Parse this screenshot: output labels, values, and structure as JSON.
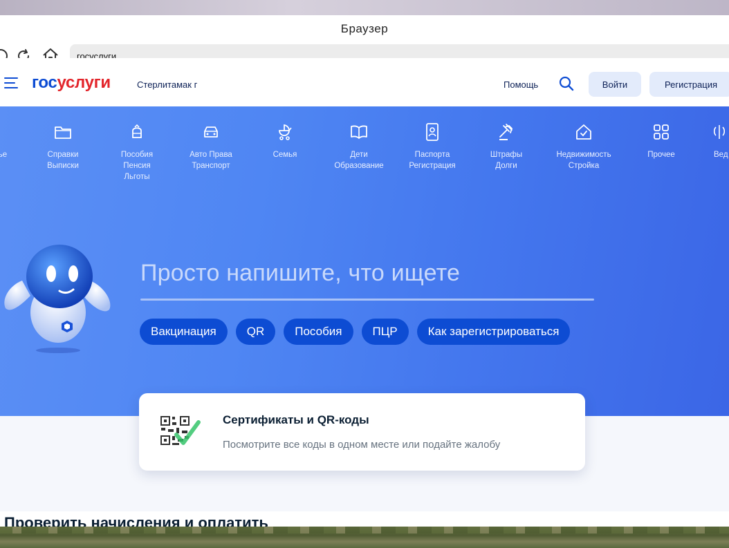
{
  "browser": {
    "title": "Браузер",
    "address": "госуслуги"
  },
  "header": {
    "logo_part1": "гос",
    "logo_part2": "услуги",
    "city": "Стерлитамак г",
    "help": "Помощь",
    "login": "Войти",
    "register": "Регистрация"
  },
  "categories": [
    {
      "label1": "ье",
      "label2": "",
      "label3": "",
      "icon": "partial-icon"
    },
    {
      "label1": "Справки",
      "label2": "Выписки",
      "label3": "",
      "icon": "folder-icon"
    },
    {
      "label1": "Пособия",
      "label2": "Пенсия",
      "label3": "Льготы",
      "icon": "wallet-icon"
    },
    {
      "label1": "Авто Права",
      "label2": "Транспорт",
      "label3": "",
      "icon": "car-icon"
    },
    {
      "label1": "Семья",
      "label2": "",
      "label3": "",
      "icon": "stroller-icon"
    },
    {
      "label1": "Дети",
      "label2": "Образование",
      "label3": "",
      "icon": "book-icon"
    },
    {
      "label1": "Паспорта",
      "label2": "Регистрация",
      "label3": "",
      "icon": "passport-icon"
    },
    {
      "label1": "Штрафы",
      "label2": "Долги",
      "label3": "",
      "icon": "gavel-icon"
    },
    {
      "label1": "Недвижимость",
      "label2": "Стройка",
      "label3": "",
      "icon": "house-icon"
    },
    {
      "label1": "Прочее",
      "label2": "",
      "label3": "",
      "icon": "grid-icon"
    },
    {
      "label1": "Вед",
      "label2": "",
      "label3": "",
      "icon": "emblem-icon"
    }
  ],
  "search": {
    "prompt": "Просто напишите, что ищете"
  },
  "chips": [
    "Вакцинация",
    "QR",
    "Пособия",
    "ПЦР",
    "Как зарегистрироваться"
  ],
  "card": {
    "title": "Сертификаты и QR-коды",
    "subtitle": "Посмотрите все коды в одном месте или подайте жалобу"
  },
  "section_heading": "Проверить начисления и оплатить",
  "colors": {
    "brand_blue": "#0d4cd3",
    "brand_red": "#e3262c",
    "hero_start": "#5b8ff5",
    "hero_end": "#3b66e6"
  }
}
